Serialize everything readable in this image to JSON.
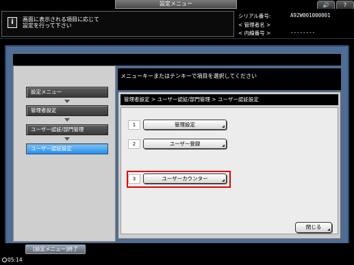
{
  "window": {
    "title": "設定メニュー",
    "volume_icon": "🔊",
    "help_label": "?"
  },
  "header": {
    "info_icon": "i",
    "message_line1": "画面に表示される項目に応じて",
    "message_line2": "設定を行って下さい",
    "serial_label": "シリアル番号:",
    "serial_value": "A92W001000001",
    "admin_label": "< 管理者名 >",
    "ext_label": "< 内線番号 >",
    "ext_value": "--------"
  },
  "nav": {
    "items": [
      {
        "label": "設定メニュー"
      },
      {
        "label": "管理者設定"
      },
      {
        "label": "ユーザー認証/部門管理"
      },
      {
        "label": "ユーザー認証設定"
      }
    ]
  },
  "main": {
    "instruction": "メニューキーまたはテンキーで項目を選択してください",
    "breadcrumb": "管理者設定 > ユーザー認証/部門管理 > ユーザー認証設定",
    "menu": [
      {
        "number": "1",
        "label": "管理設定"
      },
      {
        "number": "2",
        "label": "ユーザー登録"
      },
      {
        "number": "3",
        "label": "ユーザーカウンター"
      }
    ],
    "close_label": "閉じる"
  },
  "footer": {
    "end_label": "[設定メニュー]終了",
    "time": "05:14"
  },
  "colors": {
    "frame": "#4f6d94",
    "active_nav": "#2b8ee8",
    "highlight": "#e00000"
  }
}
